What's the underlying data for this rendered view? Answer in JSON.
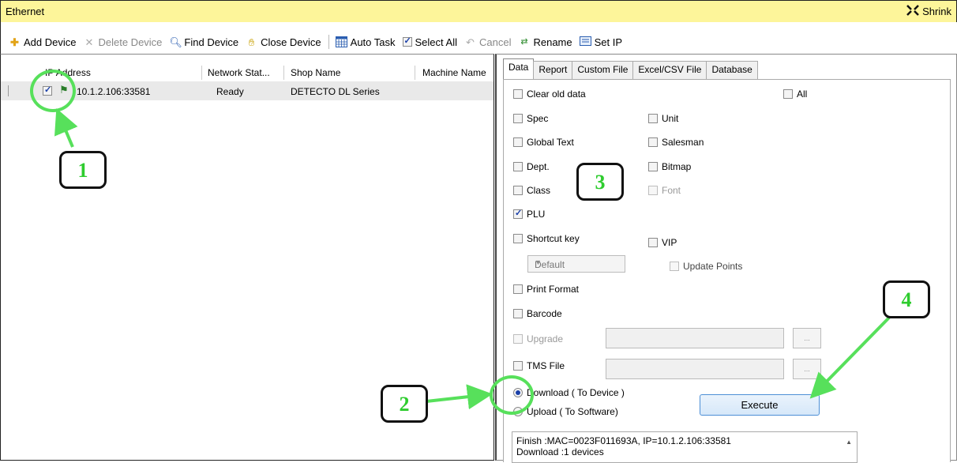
{
  "window": {
    "title": "Ethernet",
    "shrink_label": "Shrink"
  },
  "toolbar": {
    "add_device": "Add Device",
    "delete_device": "Delete Device",
    "find_device": "Find Device",
    "close_device": "Close Device",
    "auto_task": "Auto Task",
    "select_all": "Select All",
    "cancel": "Cancel",
    "rename": "Rename",
    "set_ip": "Set IP"
  },
  "device_grid": {
    "columns": [
      "IP Address",
      "Network Stat...",
      "Shop Name",
      "Machine Name"
    ],
    "rows": [
      {
        "ip": "10.1.2.106:33581",
        "status": "Ready",
        "shop": "DETECTO DL Series",
        "machine": "",
        "checked": true
      }
    ]
  },
  "tabs": [
    "Data",
    "Report",
    "Custom File",
    "Excel/CSV File",
    "Database"
  ],
  "data_tab": {
    "clear_old_data": "Clear old data",
    "all": "All",
    "spec": "Spec",
    "unit": "Unit",
    "global_text": "Global Text",
    "salesman": "Salesman",
    "dept": "Dept.",
    "bitmap": "Bitmap",
    "class": "Class",
    "font": "Font",
    "plu": "PLU",
    "shortcut_key": "Shortcut key",
    "vip": "VIP",
    "shortcut_select": "Default",
    "update_points": "Update Points",
    "print_format": "Print Format",
    "barcode": "Barcode",
    "upgrade": "Upgrade",
    "tms_file": "TMS File",
    "browse": "...",
    "download": "Download ( To Device )",
    "upload": "Upload ( To Software)",
    "execute": "Execute",
    "log_line1": "Finish :MAC=0023F011693A, IP=10.1.2.106:33581",
    "log_line2": "Download :1 devices"
  },
  "callouts": {
    "c1": "1",
    "c2": "2",
    "c3": "3",
    "c4": "4"
  },
  "colors": {
    "titlebar": "#fdf59a",
    "callout_text": "#2ecc2e",
    "highlight_ring": "#57e05b"
  }
}
